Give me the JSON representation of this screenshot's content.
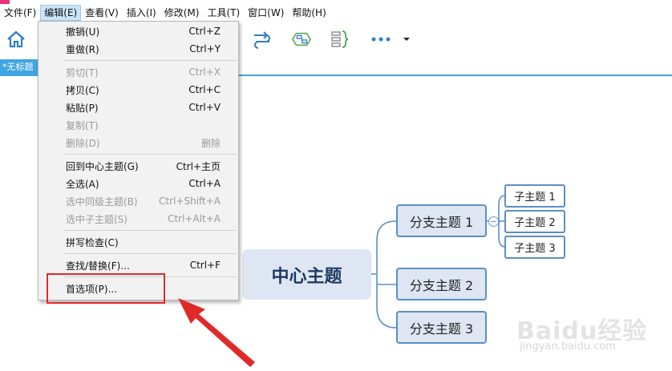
{
  "menubar": {
    "items": [
      {
        "label": "文件(F)"
      },
      {
        "label": "编辑(E)"
      },
      {
        "label": "查看(V)"
      },
      {
        "label": "插入(I)"
      },
      {
        "label": "修改(M)"
      },
      {
        "label": "工具(T)"
      },
      {
        "label": "窗口(W)"
      },
      {
        "label": "帮助(H)"
      }
    ]
  },
  "toolbar": {
    "icons": [
      "home-icon",
      "flow-arrows-icon",
      "boundary-icon",
      "summary-brace-icon",
      "more-dots-icon",
      "dropdown-arrow-icon"
    ]
  },
  "document": {
    "tab_label": "*无标题"
  },
  "edit_menu": {
    "items": [
      {
        "label": "撤销(U)",
        "shortcut": "Ctrl+Z",
        "enabled": true
      },
      {
        "label": "重做(R)",
        "shortcut": "Ctrl+Y",
        "enabled": true
      },
      {
        "label": "剪切(T)",
        "shortcut": "Ctrl+X",
        "enabled": false
      },
      {
        "label": "拷贝(C)",
        "shortcut": "Ctrl+C",
        "enabled": true
      },
      {
        "label": "粘贴(P)",
        "shortcut": "Ctrl+V",
        "enabled": true
      },
      {
        "label": "复制(T)",
        "shortcut": "",
        "enabled": false
      },
      {
        "label": "删除(D)",
        "shortcut": "删除",
        "enabled": false
      },
      {
        "label": "回到中心主题(G)",
        "shortcut": "Ctrl+主页",
        "enabled": true
      },
      {
        "label": "全选(A)",
        "shortcut": "Ctrl+A",
        "enabled": true
      },
      {
        "label": "选中同级主题(B)",
        "shortcut": "Ctrl+Shift+A",
        "enabled": false
      },
      {
        "label": "选中子主题(S)",
        "shortcut": "Ctrl+Alt+A",
        "enabled": false
      },
      {
        "label": "拼写检查(C)",
        "shortcut": "",
        "enabled": true
      },
      {
        "label": "查找/替换(F)...",
        "shortcut": "Ctrl+F",
        "enabled": true
      },
      {
        "label": "首选项(P)...",
        "shortcut": "",
        "enabled": true
      }
    ]
  },
  "mindmap": {
    "central": "中心主题",
    "branches": [
      "分支主题 1",
      "分支主题 2",
      "分支主题 3"
    ],
    "subtopics": [
      "子主题 1",
      "子主题 2",
      "子主题 3"
    ]
  },
  "watermark": {
    "text": "Baidu经验",
    "url": "jingyan.baidu.com"
  },
  "colors": {
    "accent": "#3fa5e0",
    "node_border": "#5a8fc8",
    "node_fill": "#dde6f2",
    "highlight": "#e02a2a",
    "brand_pink": "#e8337a"
  }
}
